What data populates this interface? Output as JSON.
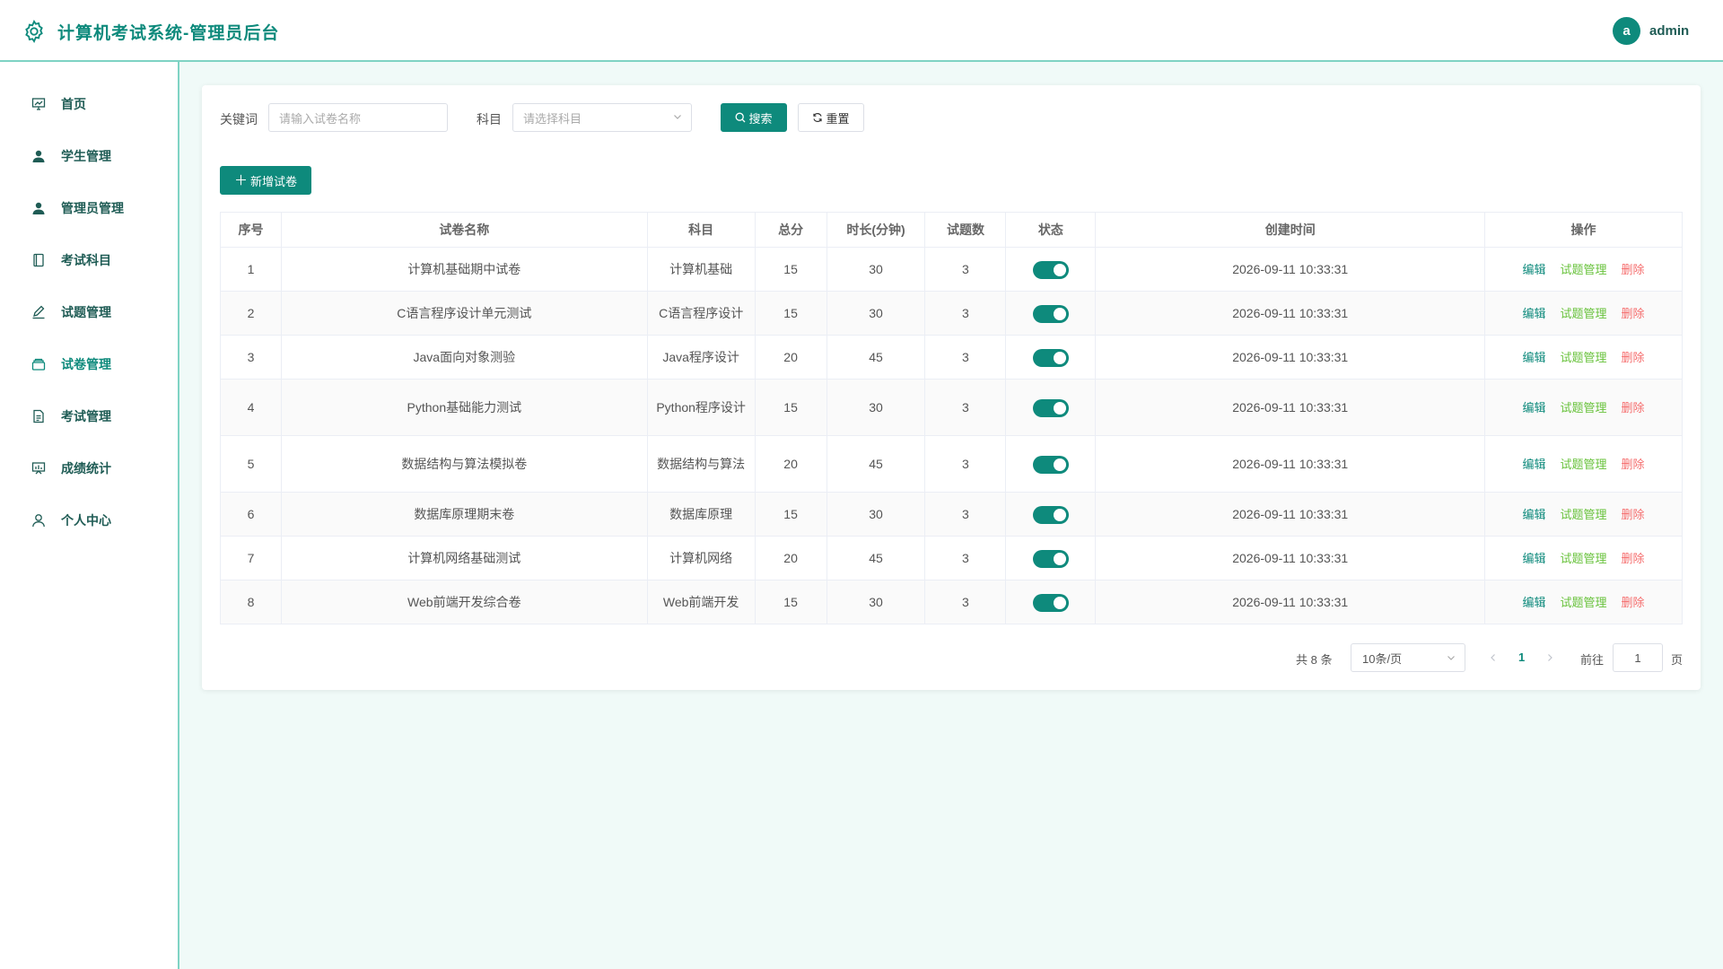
{
  "header": {
    "title": "计算机考试系统-管理员后台",
    "avatar_letter": "a",
    "username": "admin"
  },
  "sidebar": {
    "items": [
      {
        "label": "首页",
        "icon": "dashboard-icon"
      },
      {
        "label": "学生管理",
        "icon": "user-icon"
      },
      {
        "label": "管理员管理",
        "icon": "user-icon"
      },
      {
        "label": "考试科目",
        "icon": "notebook-icon"
      },
      {
        "label": "试题管理",
        "icon": "edit-pen-icon"
      },
      {
        "label": "试卷管理",
        "icon": "box-icon"
      },
      {
        "label": "考试管理",
        "icon": "document-icon"
      },
      {
        "label": "成绩统计",
        "icon": "chart-icon"
      },
      {
        "label": "个人中心",
        "icon": "user-outline-icon"
      }
    ],
    "active": "试卷管理"
  },
  "filters": {
    "keyword_label": "关键词",
    "keyword_placeholder": "请输入试卷名称",
    "subject_label": "科目",
    "subject_placeholder": "请选择科目",
    "search_label": "搜索",
    "reset_label": "重置",
    "add_label": "新增试卷"
  },
  "table": {
    "columns": [
      "序号",
      "试卷名称",
      "科目",
      "总分",
      "时长(分钟)",
      "试题数",
      "状态",
      "创建时间",
      "操作"
    ],
    "rows": [
      {
        "no": "1",
        "name": "计算机基础期中试卷",
        "subject": "计算机基础",
        "score": "15",
        "duration": "30",
        "count": "3",
        "status": true,
        "created": "2026-09-11 10:33:31"
      },
      {
        "no": "2",
        "name": "C语言程序设计单元测试",
        "subject": "C语言程序设计",
        "score": "15",
        "duration": "30",
        "count": "3",
        "status": true,
        "created": "2026-09-11 10:33:31"
      },
      {
        "no": "3",
        "name": "Java面向对象测验",
        "subject": "Java程序设计",
        "score": "20",
        "duration": "45",
        "count": "3",
        "status": true,
        "created": "2026-09-11 10:33:31"
      },
      {
        "no": "4",
        "name": "Python基础能力测试",
        "subject": "Python程序设计",
        "score": "15",
        "duration": "30",
        "count": "3",
        "status": true,
        "created": "2026-09-11 10:33:31"
      },
      {
        "no": "5",
        "name": "数据结构与算法模拟卷",
        "subject": "数据结构与算法",
        "score": "20",
        "duration": "45",
        "count": "3",
        "status": true,
        "created": "2026-09-11 10:33:31"
      },
      {
        "no": "6",
        "name": "数据库原理期末卷",
        "subject": "数据库原理",
        "score": "15",
        "duration": "30",
        "count": "3",
        "status": true,
        "created": "2026-09-11 10:33:31"
      },
      {
        "no": "7",
        "name": "计算机网络基础测试",
        "subject": "计算机网络",
        "score": "20",
        "duration": "45",
        "count": "3",
        "status": true,
        "created": "2026-09-11 10:33:31"
      },
      {
        "no": "8",
        "name": "Web前端开发综合卷",
        "subject": "Web前端开发",
        "score": "15",
        "duration": "30",
        "count": "3",
        "status": true,
        "created": "2026-09-11 10:33:31"
      }
    ],
    "actions": {
      "edit": "编辑",
      "questions": "试题管理",
      "delete": "删除"
    }
  },
  "pagination": {
    "total_text": "共 8 条",
    "page_size": "10条/页",
    "current_page": "1",
    "goto_label": "前往",
    "goto_value": "1",
    "page_suffix": "页"
  },
  "colors": {
    "primary": "#0e8a7c",
    "success": "#67c23a",
    "danger": "#f56c6c",
    "background": "#f0faf8"
  }
}
